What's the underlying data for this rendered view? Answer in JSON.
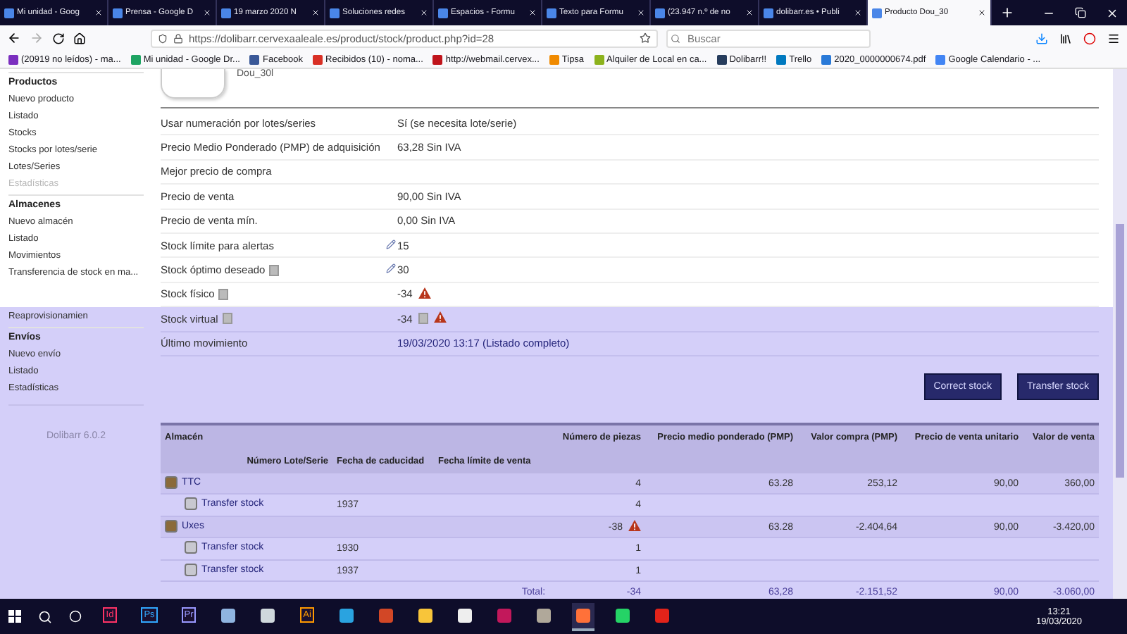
{
  "browser": {
    "tabs": [
      {
        "label": "Mi unidad - Goog",
        "selected": false
      },
      {
        "label": "Prensa - Google D",
        "selected": false
      },
      {
        "label": "19 marzo 2020 N",
        "selected": false
      },
      {
        "label": "Soluciones redes",
        "selected": false
      },
      {
        "label": "Espacios - Formu",
        "selected": false
      },
      {
        "label": "Texto para Formu",
        "selected": false
      },
      {
        "label": "(23.947 n.º de no",
        "selected": false
      },
      {
        "label": "dolibarr.es • Publi",
        "selected": false
      },
      {
        "label": "Producto Dou_30",
        "selected": true
      }
    ],
    "address": "https://dolibarr.cervexaaleale.es/product/stock/product.php?id=28",
    "search": {
      "placeholder": "Buscar"
    },
    "bookmarks": [
      {
        "label": "(20919 no leídos) - ma...",
        "color": "#7b2fbf"
      },
      {
        "label": "Mi unidad - Google Dr...",
        "color": "#1fa463"
      },
      {
        "label": "Facebook",
        "color": "#3b5998"
      },
      {
        "label": "Recibidos (10) - noma...",
        "color": "#d93025"
      },
      {
        "label": "http://webmail.cervex...",
        "color": "#c0141b"
      },
      {
        "label": "Tipsa",
        "color": "#f08a00"
      },
      {
        "label": "Alquiler de Local en ca...",
        "color": "#8cb21d"
      },
      {
        "label": "Dolibarr!!",
        "color": "#263c5c"
      },
      {
        "label": "Trello",
        "color": "#0079bf"
      },
      {
        "label": "2020_0000000674.pdf",
        "color": "#2a7ad8"
      },
      {
        "label": "Google Calendario - ...",
        "color": "#4285f4"
      }
    ]
  },
  "sidebar": {
    "sections": [
      {
        "title": "Productos",
        "items": [
          {
            "label": "Nuevo producto",
            "disabled": false
          },
          {
            "label": "Listado",
            "disabled": false
          },
          {
            "label": "Stocks",
            "disabled": false
          },
          {
            "label": "Stocks por lotes/serie",
            "disabled": false
          },
          {
            "label": "Lotes/Series",
            "disabled": false
          },
          {
            "label": "Estadísticas",
            "disabled": true
          }
        ]
      },
      {
        "title": "Almacenes",
        "items": [
          {
            "label": "Nuevo almacén",
            "disabled": false
          },
          {
            "label": "Listado",
            "disabled": false
          },
          {
            "label": "Movimientos",
            "disabled": false
          },
          {
            "label": "Transferencia de stock en ma...",
            "disabled": false
          }
        ]
      }
    ],
    "highlighted_items": [
      {
        "label": "Reaprovisionamien",
        "disabled": false
      }
    ],
    "lower_sections": [
      {
        "title": "Envíos",
        "items": [
          {
            "label": "Nuevo envío",
            "disabled": false
          },
          {
            "label": "Listado",
            "disabled": false
          },
          {
            "label": "Estadísticas",
            "disabled": false
          }
        ]
      }
    ],
    "version": "Dolibarr 6.0.2"
  },
  "product": {
    "ref": "Dou_30l",
    "fields": [
      {
        "label": "Usar numeración por lotes/series",
        "value": "Sí (se necesita lote/serie)",
        "info": false,
        "editable": false,
        "value_info": false,
        "warning": false,
        "link": false
      },
      {
        "label": "Precio Medio Ponderado (PMP) de adquisición",
        "value": "63,28 Sin IVA",
        "info": false,
        "editable": false,
        "value_info": false,
        "warning": false,
        "link": false
      },
      {
        "label": "Mejor precio de compra",
        "info": false,
        "editable": false,
        "value_info": false,
        "warning": false,
        "link": false
      },
      {
        "label": "Precio de venta",
        "value": "90,00 Sin IVA",
        "info": false,
        "editable": false,
        "value_info": false,
        "warning": false,
        "link": false
      },
      {
        "label": "Precio de venta mín.",
        "value": "0,00 Sin IVA",
        "info": false,
        "editable": false,
        "value_info": false,
        "warning": false,
        "link": false
      },
      {
        "label": "Stock límite para alertas",
        "value": "15",
        "info": false,
        "editable": true,
        "value_info": false,
        "warning": false,
        "link": false
      },
      {
        "label": "Stock óptimo deseado",
        "value": "30",
        "info": true,
        "editable": true,
        "value_info": false,
        "warning": false,
        "link": false
      },
      {
        "label": "Stock físico",
        "value": "-34",
        "info": true,
        "editable": false,
        "value_info": false,
        "warning": true,
        "link": false
      }
    ],
    "highlighted_fields": [
      {
        "label": "Stock virtual",
        "value": "-34",
        "info": true,
        "editable": false,
        "value_info": true,
        "warning": true,
        "link": false
      },
      {
        "label": "Último movimiento",
        "value": "19/03/2020 13:17 (Listado completo)",
        "info": false,
        "editable": false,
        "value_info": false,
        "warning": false,
        "link": true
      }
    ],
    "buttons": [
      "Correct stock",
      "Transfer stock"
    ]
  },
  "stock_table": {
    "columns": [
      "Almacén",
      "Número de piezas",
      "Precio medio ponderado (PMP)",
      "Valor compra (PMP)",
      "Precio de venta unitario",
      "Valor de venta"
    ],
    "lot_columns": [
      "Número Lote/Serie",
      "Fecha de caducidad",
      "Fecha límite de venta"
    ],
    "rows": [
      {
        "kind": "warehouse",
        "name": "TTC",
        "pieces": "4",
        "pmp": "63.28",
        "purchase_value": "253,12",
        "unit_price": "90,00",
        "sale_value": "360,00",
        "warning": false
      },
      {
        "kind": "lot",
        "name": "Transfer stock",
        "lot": "1937",
        "pieces": "4",
        "warning": false
      },
      {
        "kind": "warehouse",
        "name": "Uxes",
        "pieces": "-38",
        "pmp": "63.28",
        "purchase_value": "-2.404,64",
        "unit_price": "90,00",
        "sale_value": "-3.420,00",
        "warning": true
      },
      {
        "kind": "lot",
        "name": "Transfer stock",
        "lot": "1930",
        "pieces": "1",
        "warning": false
      },
      {
        "kind": "lot",
        "name": "Transfer stock",
        "lot": "1937",
        "pieces": "1",
        "warning": false
      },
      {
        "kind": "total",
        "name": "Total:",
        "pieces": "-34",
        "pmp": "63,28",
        "purchase_value": "-2.151,52",
        "unit_price": "90,00",
        "sale_value": "-3.060,00",
        "warning": false
      }
    ]
  },
  "taskbar": {
    "apps": [
      {
        "kind": "text",
        "label": "Id",
        "color": "#ff3366",
        "selected": false
      },
      {
        "kind": "text",
        "label": "Ps",
        "color": "#31a8ff",
        "selected": false
      },
      {
        "kind": "text",
        "label": "Pr",
        "color": "#9999ff",
        "selected": false
      },
      {
        "kind": "icon",
        "color": "#8fb4e0",
        "selected": false
      },
      {
        "kind": "icon",
        "color": "#cfd8dc",
        "selected": false
      },
      {
        "kind": "text",
        "label": "Ai",
        "color": "#ff9a00",
        "selected": false
      },
      {
        "kind": "icon",
        "color": "#2aa3e0",
        "selected": false
      },
      {
        "kind": "icon",
        "color": "#d24726",
        "selected": false
      },
      {
        "kind": "icon",
        "color": "#f8c53a",
        "selected": false
      },
      {
        "kind": "icon",
        "color": "#eeeeee",
        "selected": false
      },
      {
        "kind": "icon",
        "color": "#c2185b",
        "selected": false
      },
      {
        "kind": "icon",
        "color": "#b0a89a",
        "selected": false
      },
      {
        "kind": "icon",
        "color": "#ff7139",
        "selected": true
      },
      {
        "kind": "icon",
        "color": "#25d366",
        "selected": false
      },
      {
        "kind": "icon",
        "color": "#e2231a",
        "selected": false
      }
    ],
    "time": "13:21",
    "date": "19/03/2020"
  }
}
